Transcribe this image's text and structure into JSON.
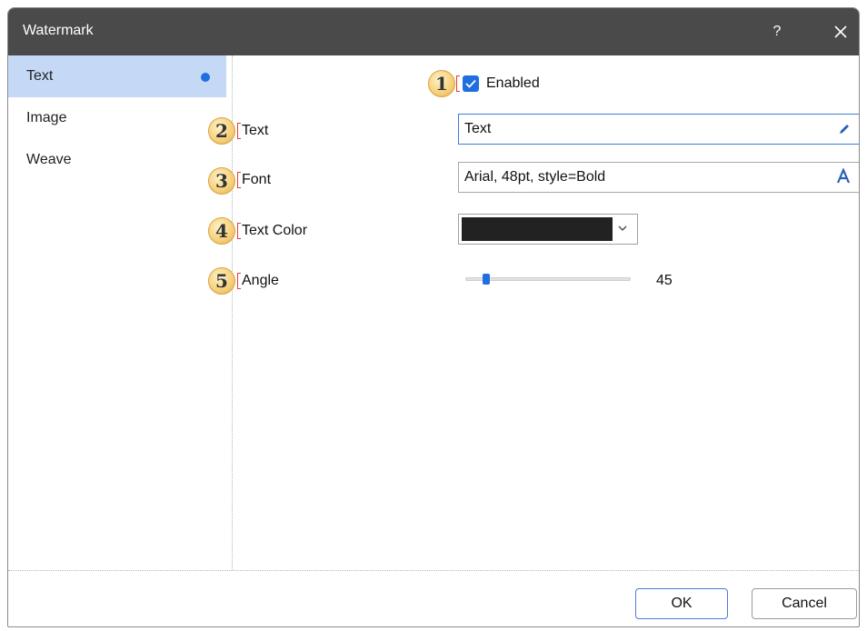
{
  "window": {
    "title": "Watermark",
    "help_label": "?"
  },
  "sidebar": {
    "items": [
      {
        "label": "Text",
        "selected": true
      },
      {
        "label": "Image",
        "selected": false
      },
      {
        "label": "Weave",
        "selected": false
      }
    ]
  },
  "form": {
    "enabled": {
      "badge": "1",
      "label": "Enabled",
      "checked": true
    },
    "text": {
      "badge": "2",
      "label": "Text",
      "value": "Text",
      "icon": "pencil-icon"
    },
    "font": {
      "badge": "3",
      "label": "Font",
      "value": "Arial, 48pt, style=Bold",
      "icon": "font-icon"
    },
    "text_color": {
      "badge": "4",
      "label": "Text Color",
      "value_color": "#222222"
    },
    "angle": {
      "badge": "5",
      "label": "Angle",
      "value": "45",
      "min": 0,
      "max": 360
    }
  },
  "footer": {
    "ok_label": "OK",
    "cancel_label": "Cancel"
  },
  "colors": {
    "accent": "#1f6fe0",
    "titlebar": "#4a4a4a",
    "selection": "#c5d9f7",
    "badge": "#f5cf7a",
    "bracket": "#e23b3b"
  }
}
